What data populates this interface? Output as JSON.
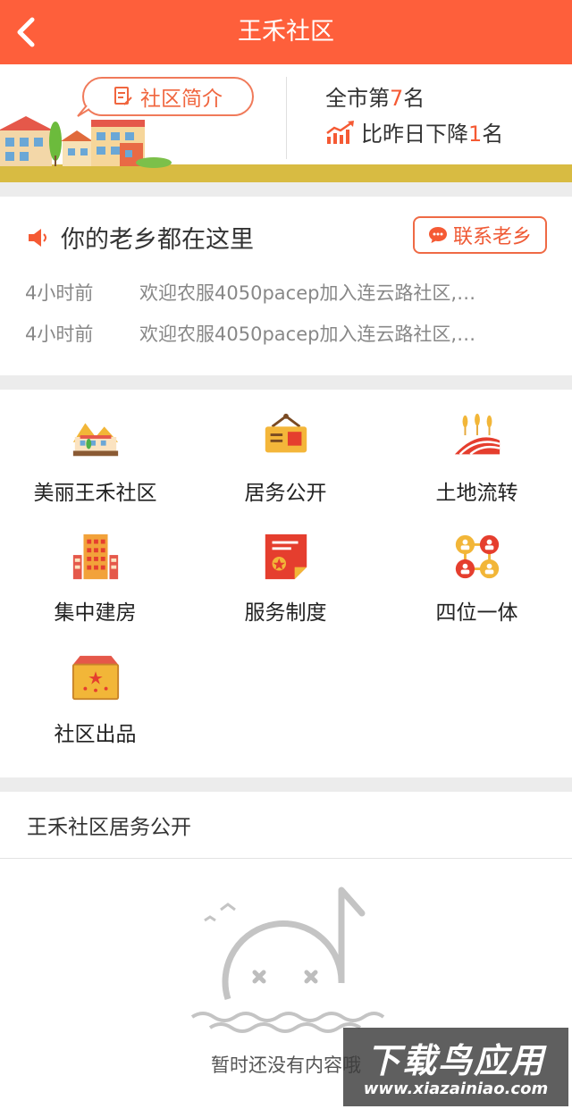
{
  "header": {
    "title": "王禾社区",
    "back_icon": "chevron-left-icon"
  },
  "hero": {
    "intro_label": "社区简介",
    "intro_icon": "document-pen-icon",
    "rank_prefix": "全市第",
    "rank_value": "7",
    "rank_suffix": "名",
    "trend_prefix": "比昨日下降",
    "trend_value": "1",
    "trend_suffix": "名",
    "trend_icon": "trend-chart-icon"
  },
  "fellow": {
    "title": "你的老乡都在这里",
    "speaker_icon": "speaker-icon",
    "contact_label": "联系老乡",
    "contact_icon": "chat-bubble-icon",
    "feed": [
      {
        "time": "4小时前",
        "message": "欢迎农服4050pacep加入连云路社区,…"
      },
      {
        "time": "4小时前",
        "message": "欢迎农服4050pacep加入连云路社区,…"
      }
    ]
  },
  "menu": [
    {
      "label": "美丽王禾社区",
      "icon": "village-icon"
    },
    {
      "label": "居务公开",
      "icon": "notice-board-icon"
    },
    {
      "label": "土地流转",
      "icon": "wheat-field-icon"
    },
    {
      "label": "集中建房",
      "icon": "building-icon"
    },
    {
      "label": "服务制度",
      "icon": "certificate-icon"
    },
    {
      "label": "四位一体",
      "icon": "people-network-icon"
    },
    {
      "label": "社区出品",
      "icon": "product-box-icon"
    }
  ],
  "public_section": {
    "title": "王禾社区居务公开",
    "empty_text": "暂时还没有内容哦",
    "empty_icon": "empty-note-icon"
  },
  "watermark": {
    "title": "下载鸟应用",
    "url": "www.xiazainiao.com"
  },
  "colors": {
    "brand": "#fe5f3b",
    "accent": "#f55a34",
    "ground": "#d8bb42"
  }
}
